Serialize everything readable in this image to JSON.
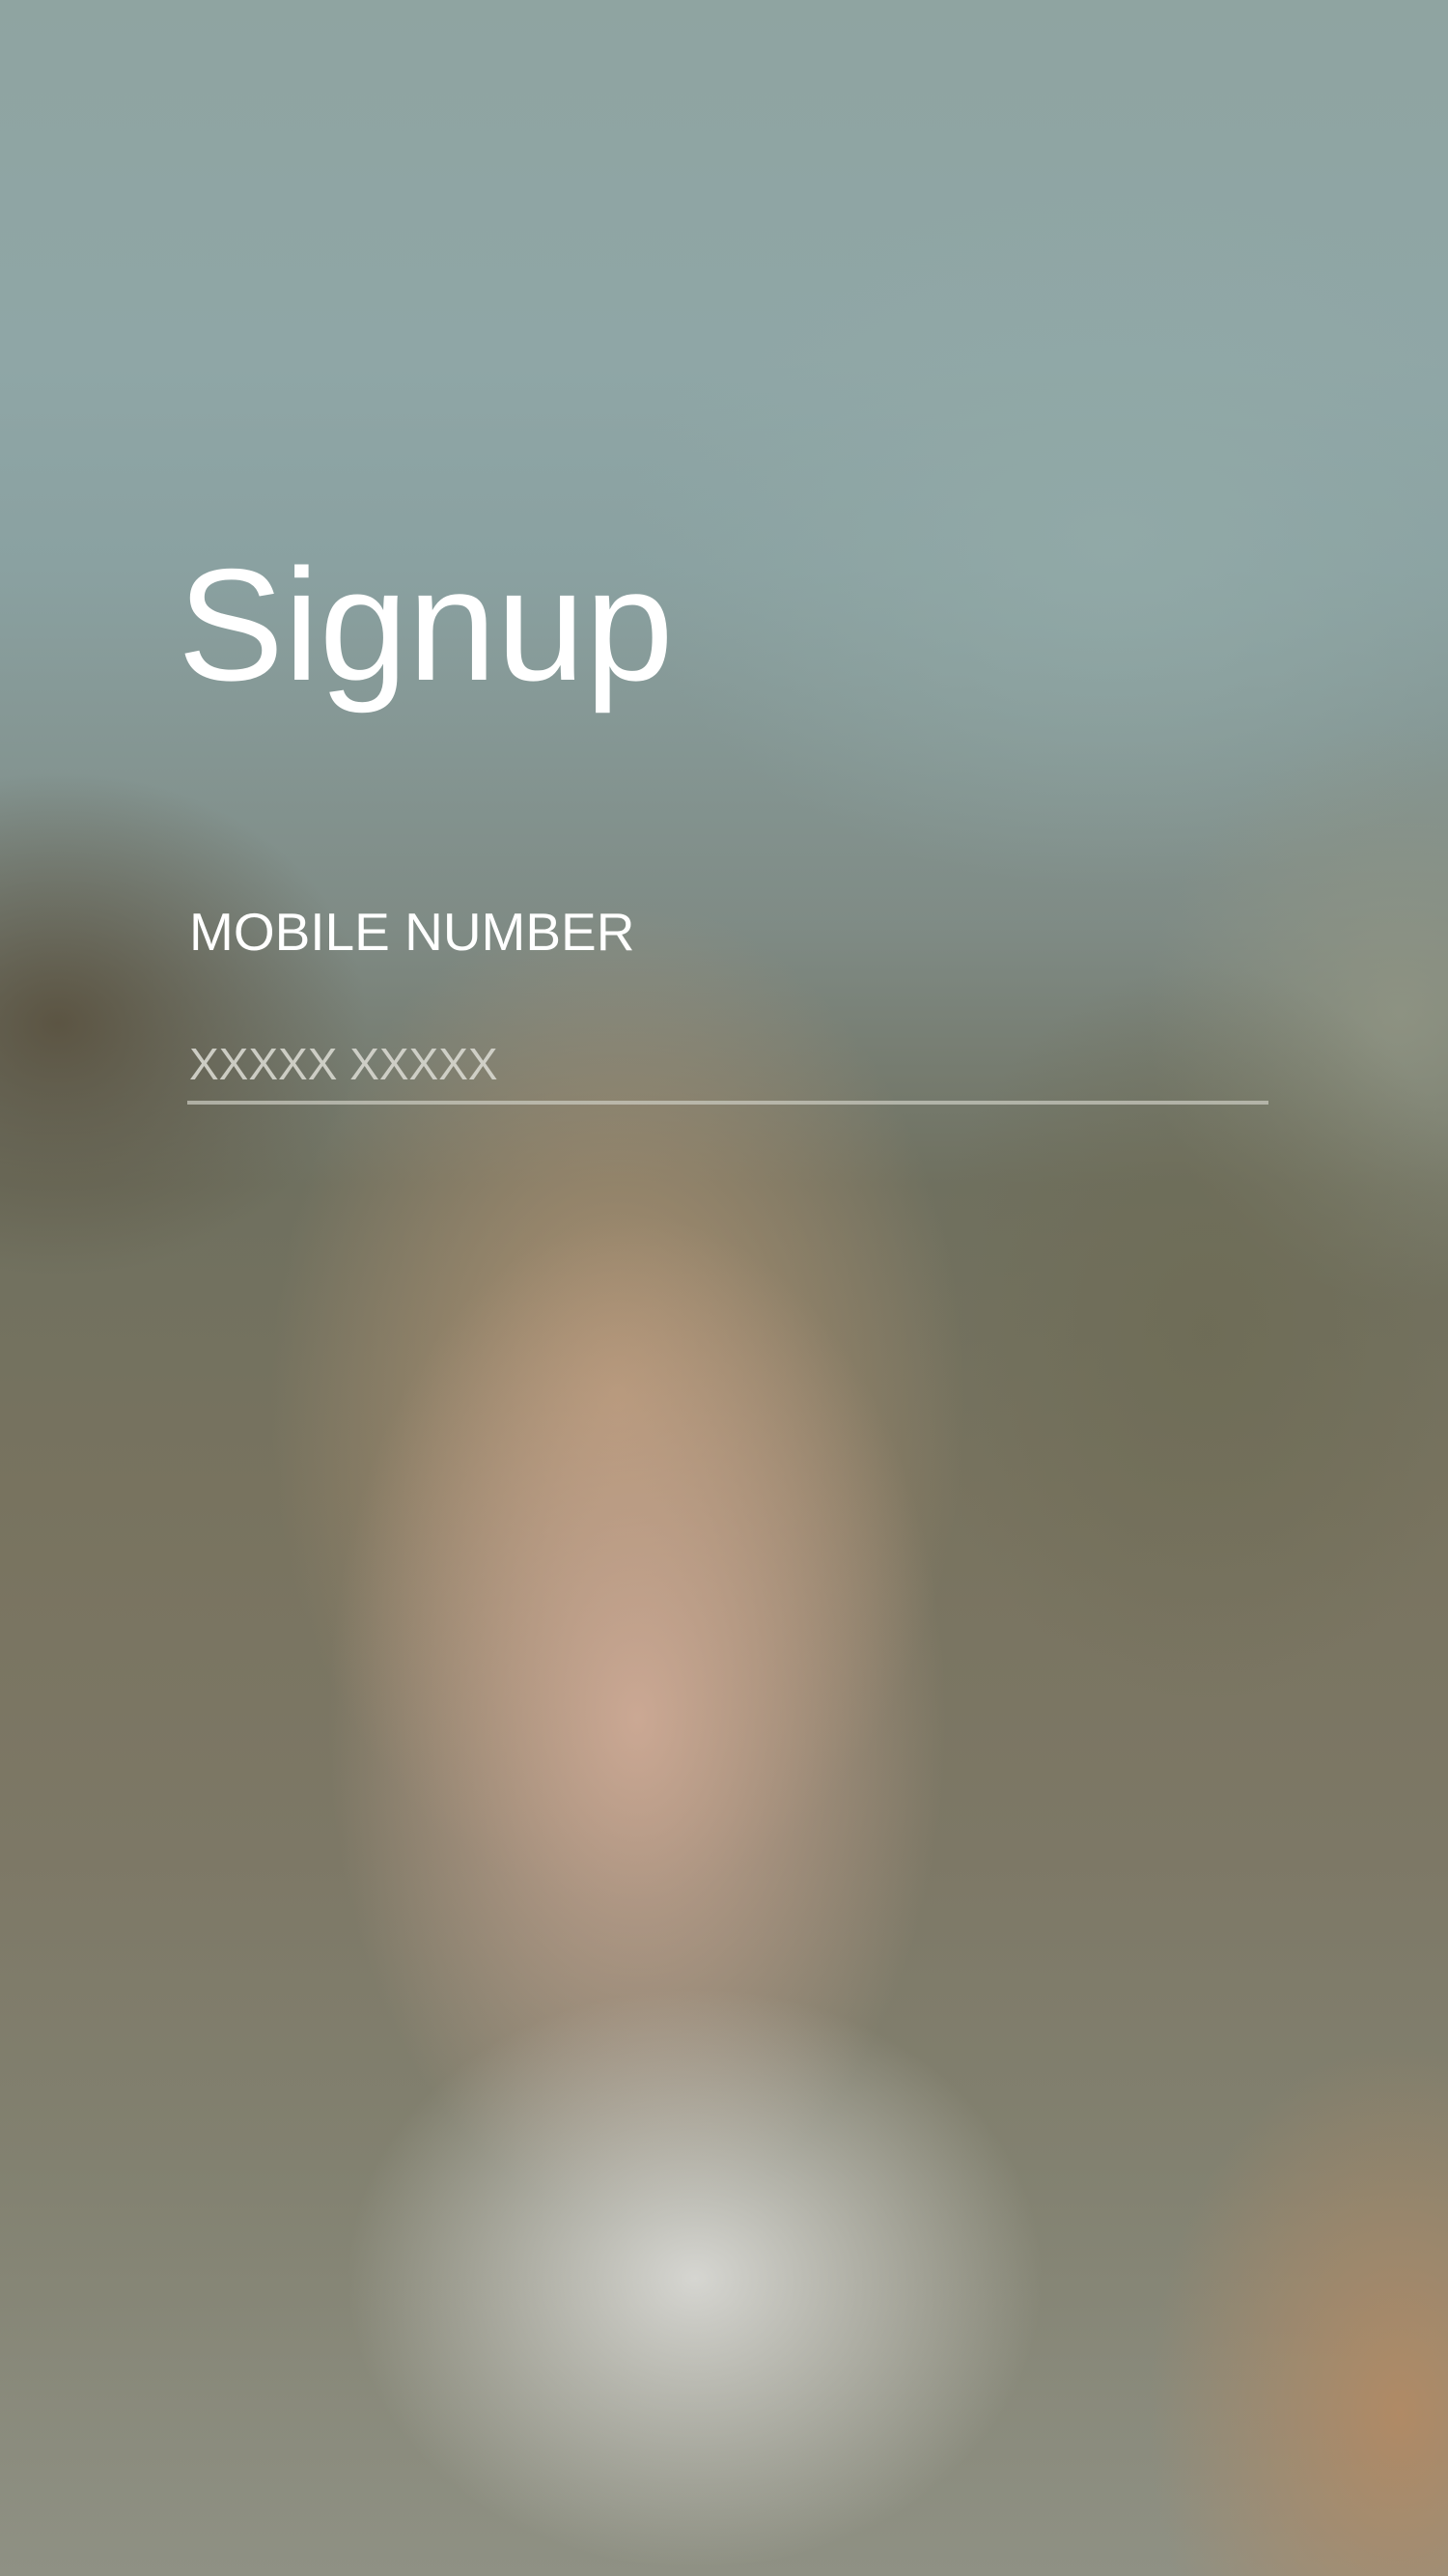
{
  "screen": {
    "title": "Signup"
  },
  "form": {
    "mobile_number": {
      "label": "MOBILE NUMBER",
      "value": "",
      "placeholder": "XXXXX XXXXX"
    }
  }
}
